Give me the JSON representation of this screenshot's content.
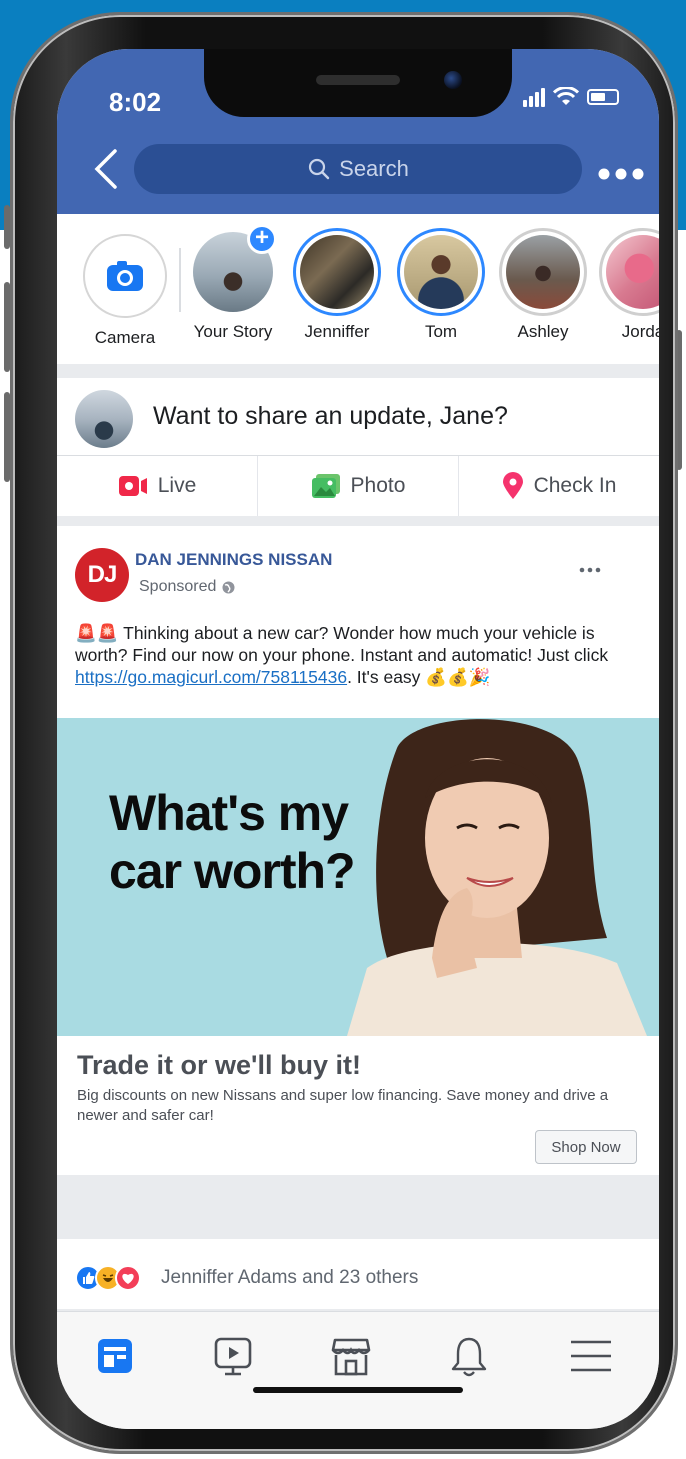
{
  "status_bar": {
    "time": "8:02"
  },
  "header": {
    "search_placeholder": "Search"
  },
  "stories": [
    {
      "label": "Camera",
      "type": "camera"
    },
    {
      "label": "Your Story",
      "type": "own"
    },
    {
      "label": "Jenniffer",
      "type": "unseen"
    },
    {
      "label": "Tom",
      "type": "unseen"
    },
    {
      "label": "Ashley",
      "type": "seen"
    },
    {
      "label": "Jorda",
      "type": "seen"
    }
  ],
  "composer": {
    "prompt": "Want to share an update, Jane?"
  },
  "composer_actions": [
    {
      "label": "Live",
      "icon": "live-video-icon"
    },
    {
      "label": "Photo",
      "icon": "photo-icon"
    },
    {
      "label": "Check In",
      "icon": "location-pin-icon"
    }
  ],
  "post": {
    "page_initials": "DJ",
    "page_name": "DAN JENNINGS NISSAN",
    "sponsored_label": "Sponsored",
    "body_lead": "🚨🚨 Thinking about a new car? Wonder how much your vehicle is worth? Find our now on your phone. Instant and automatic! Just click ",
    "body_link": "https://go.magicurl.com/758115436",
    "body_tail": ". It's easy 💰💰🎉",
    "ad_image_headline_line1": "What's my",
    "ad_image_headline_line2": "car worth?",
    "link_title": "Trade it or we'll buy it!",
    "link_description": "Big discounts on new Nissans and super low financing. Save money and drive a newer and safer car!",
    "cta_label": "Shop Now"
  },
  "next_post": {
    "reactions_text": "Jenniffer Adams and 23 others",
    "reaction_icons": [
      "like-icon",
      "haha-icon",
      "love-icon"
    ]
  },
  "tab_bar": [
    {
      "name": "news-feed-icon",
      "active": true
    },
    {
      "name": "watch-icon",
      "active": false
    },
    {
      "name": "marketplace-icon",
      "active": false
    },
    {
      "name": "notifications-icon",
      "active": false
    },
    {
      "name": "menu-icon",
      "active": false
    }
  ],
  "colors": {
    "brand": "#4267b2",
    "accent": "#2d88ff",
    "page_logo": "#d2232a",
    "background_blue": "#0a7fc0"
  }
}
